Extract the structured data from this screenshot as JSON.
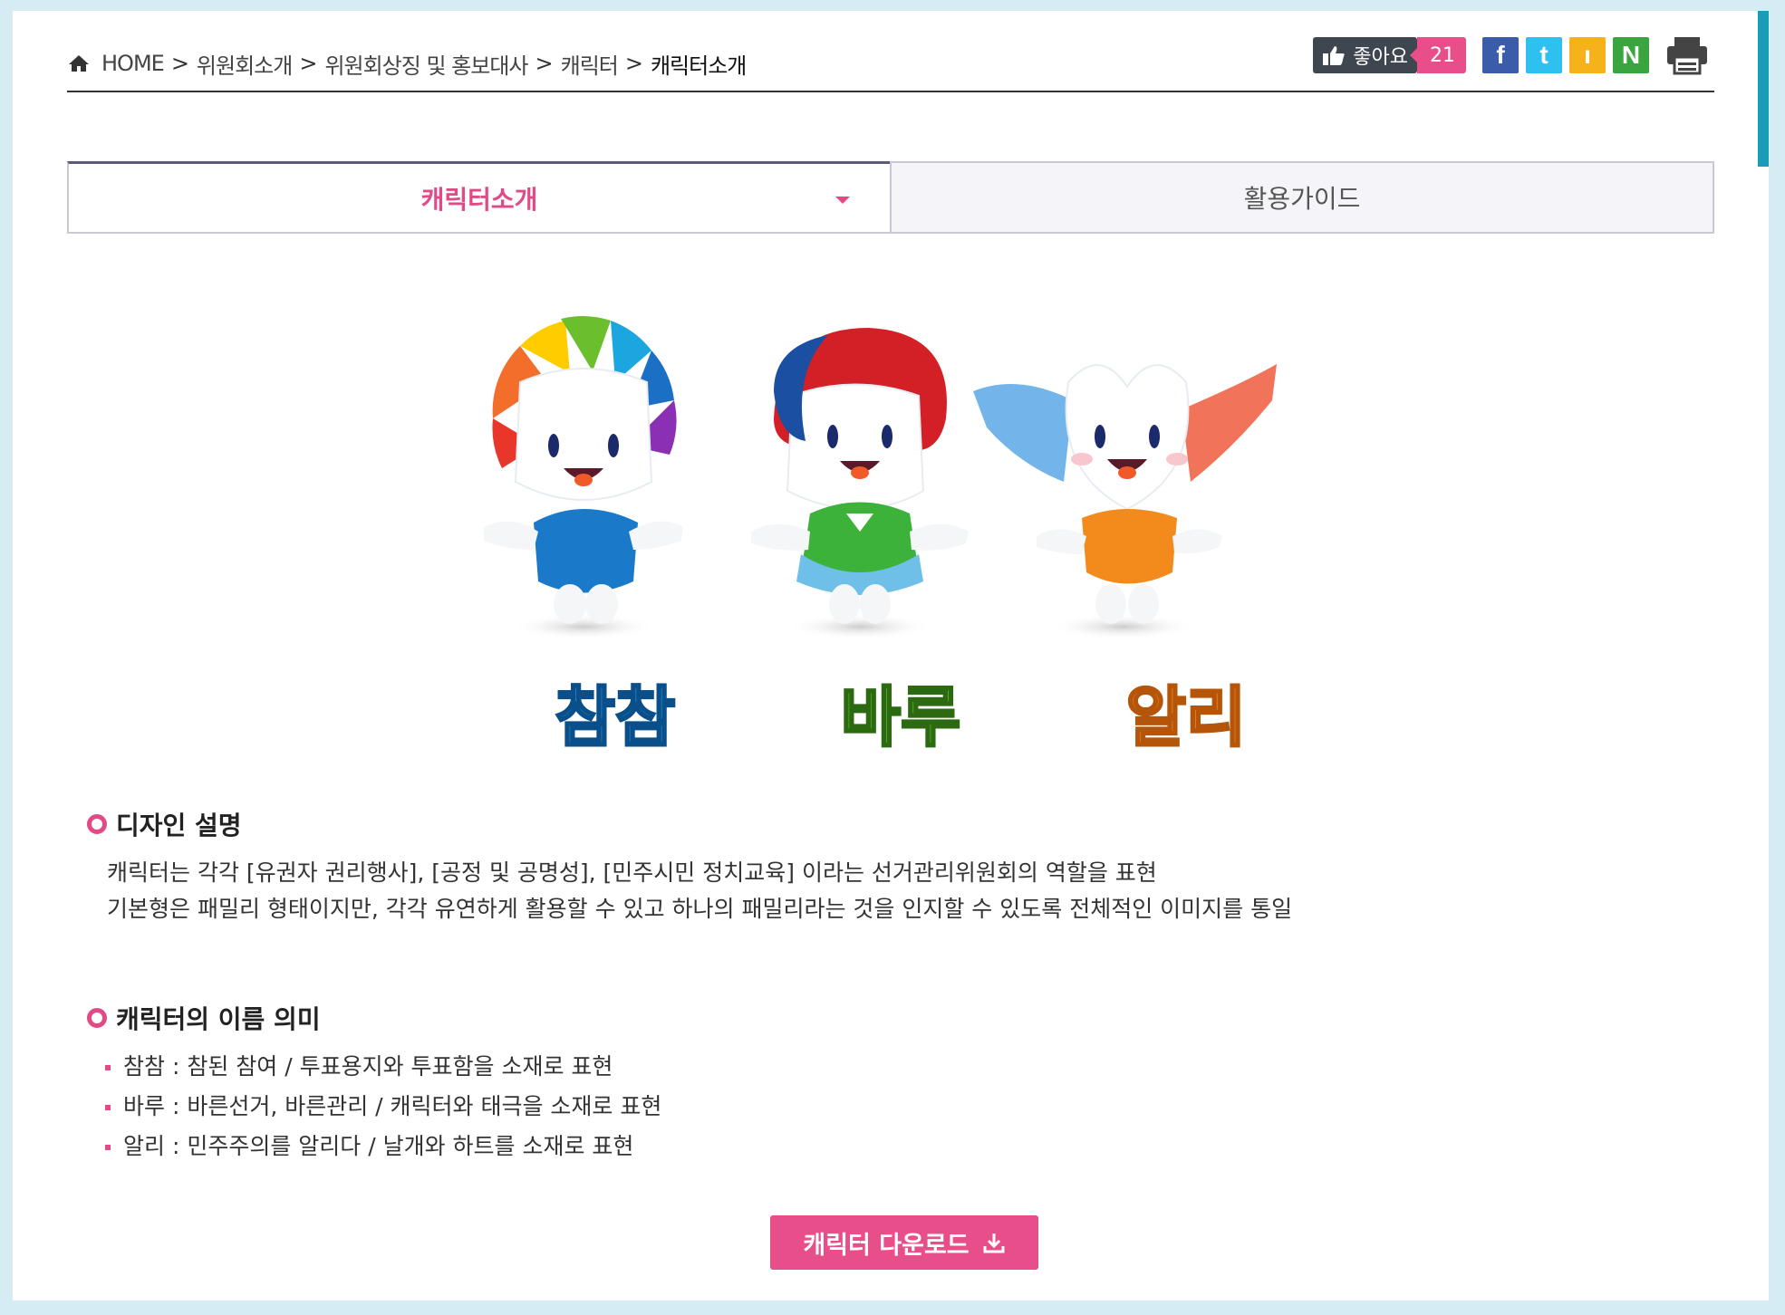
{
  "breadcrumb": {
    "home": "HOME",
    "items": [
      "위원회소개",
      "위원회상징 및 홍보대사",
      "캐릭터"
    ],
    "current": "캐릭터소개"
  },
  "share": {
    "like_label": "좋아요",
    "like_count": "21",
    "facebook": "f",
    "twitter": "t",
    "kakaostory": "ı",
    "naver": "N"
  },
  "tabs": {
    "active": "캐릭터소개",
    "inactive": "활용가이드"
  },
  "characters": {
    "names": [
      "참참",
      "바루",
      "알리"
    ],
    "colors": [
      "#1e8fd6",
      "#5cb82d",
      "#f08a1e"
    ]
  },
  "design": {
    "title": "디자인 설명",
    "lines": [
      "캐릭터는 각각 [유권자 권리행사], [공정 및 공명성], [민주시민 정치교육] 이라는 선거관리위원회의 역할을 표현",
      "기본형은 패밀리 형태이지만, 각각 유연하게 활용할 수 있고 하나의 패밀리라는 것을 인지할 수 있도록 전체적인 이미지를 통일"
    ]
  },
  "names_meaning": {
    "title": "캐릭터의 이름 의미",
    "items": [
      "참참 : 참된 참여 / 투표용지와 투표함을 소재로 표현",
      "바루 : 바른선거, 바른관리 / 캐릭터와 태극을 소재로 표현",
      "알리 : 민주주의를 알리다 / 날개와 하트를 소재로 표현"
    ]
  },
  "download_button": "캐릭터 다운로드"
}
